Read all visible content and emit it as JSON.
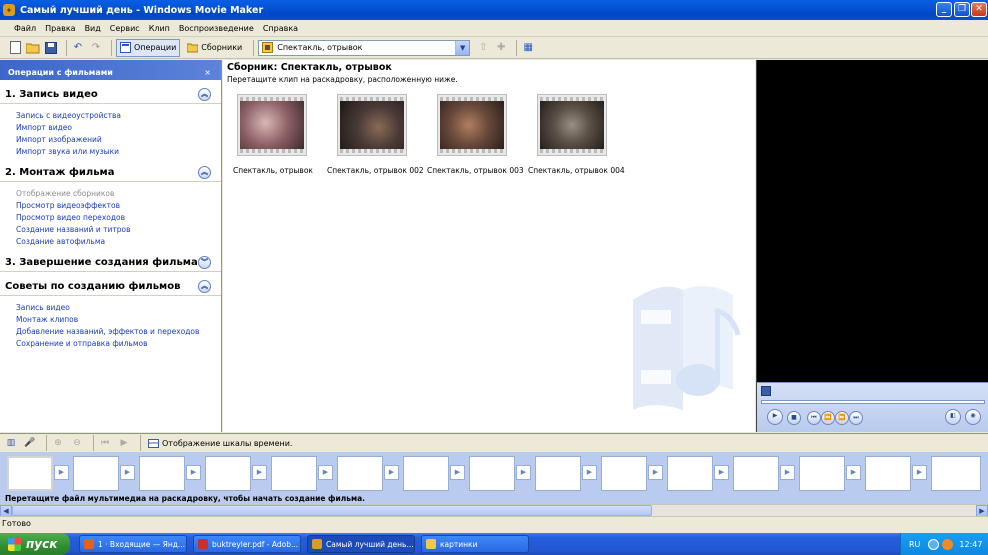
{
  "window": {
    "title": "Самый лучший день - Windows Movie Maker",
    "minimize": "_",
    "maximize": "❐",
    "close": "✕"
  },
  "menu": [
    "Файл",
    "Правка",
    "Вид",
    "Сервис",
    "Клип",
    "Воспроизведение",
    "Справка"
  ],
  "toolbar": {
    "operations_label": "Операции",
    "collections_label": "Сборники",
    "collection_value": "Спектакль, отрывок"
  },
  "tasks": {
    "header": "Операции с фильмами",
    "close": "×",
    "sections": [
      {
        "title": "1. Запись видео",
        "expanded": true,
        "items": [
          "Запись с видеоустройства",
          "Импорт видео",
          "Импорт изображений",
          "Импорт звука или музыки"
        ]
      },
      {
        "title": "2. Монтаж фильма",
        "expanded": true,
        "items": [
          "Отображение сборников",
          "Просмотр видеоэффектов",
          "Просмотр видео переходов",
          "Создание названий и титров",
          "Создание автофильма"
        ]
      },
      {
        "title": "3. Завершение создания фильма",
        "expanded": false,
        "items": []
      },
      {
        "title": "Советы по созданию фильмов",
        "expanded": true,
        "items": [
          "Запись видео",
          "Монтаж клипов",
          "Добавление названий, эффектов и переходов",
          "Сохранение и отправка фильмов"
        ]
      }
    ]
  },
  "collection": {
    "title": "Сборник: Спектакль, отрывок",
    "subtitle": "Перетащите клип на раскадровку, расположенную ниже.",
    "clips": [
      {
        "label": "Спектакль, отрывок",
        "tone": "#b88b8a"
      },
      {
        "label": "Спектакль, отрывок 002",
        "tone": "#4a3a36"
      },
      {
        "label": "Спектакль, отрывок 003",
        "tone": "#6a4a3c"
      },
      {
        "label": "Спектакль, отрывок 004",
        "tone": "#5a5046"
      }
    ]
  },
  "storyboard": {
    "timeline_label": "Отображение шкалы времени.",
    "hint": "Перетащите файл мультимедиа на раскадровку, чтобы начать создание фильма."
  },
  "status": "Готово",
  "taskbar": {
    "start": "пуск",
    "tasks": [
      {
        "label": "1 · Входящие — Янд...",
        "color": "#e0621c"
      },
      {
        "label": "buktreyler.pdf - Adob...",
        "color": "#c9302c"
      },
      {
        "label": "Самый лучший день...",
        "color": "#d89e22"
      },
      {
        "label": "картинки",
        "color": "#f3c94b"
      }
    ],
    "lang": "RU",
    "clock": "12:47"
  }
}
